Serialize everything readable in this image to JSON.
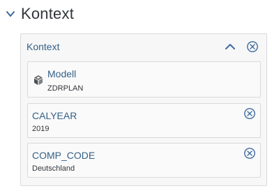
{
  "section": {
    "title": "Kontext",
    "collapse_icon": "chevron-down-icon"
  },
  "panel": {
    "title": "Kontext",
    "collapse_icon": "chevron-up-icon",
    "remove_icon": "circle-close-icon"
  },
  "cards": {
    "model": {
      "title": "Modell",
      "value": "ZDRPLAN",
      "icon": "cube-icon"
    },
    "calyear": {
      "title": "CALYEAR",
      "value": "2019",
      "remove_icon": "circle-close-icon"
    },
    "comp_code": {
      "title": "COMP_CODE",
      "value": "Deutschland",
      "remove_icon": "circle-close-icon"
    }
  },
  "colors": {
    "link_text": "#346187",
    "body_text": "#32363a",
    "border": "#d9d9d9",
    "panel_bg": "#f7f7f7"
  }
}
